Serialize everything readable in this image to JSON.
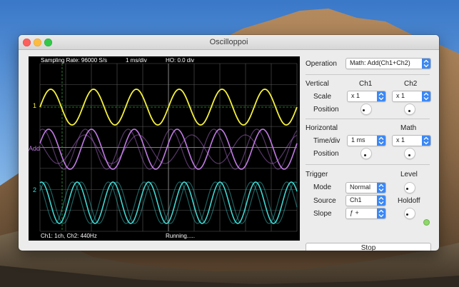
{
  "window": {
    "title": "Oscilloppoi"
  },
  "scope": {
    "sampling_rate": "Sampling Rate: 96000 S/s",
    "timebase": "1 ms/div",
    "ho": "HO: 0.0 div",
    "bottom_left": "Ch1: 1ch, Ch2: 440Hz",
    "status": "Running.....",
    "ch1_marker": "1",
    "math_marker": "Add",
    "ch2_marker": "2",
    "colors": {
      "ch1": "#f5f03c",
      "ch2": "#3fd9d4",
      "math": "#c27ae6",
      "grid": "#5a5a5a",
      "marker_ch1": "#f5f03c",
      "marker_math": "#c27ae6",
      "marker_ch2": "#3fd9d4",
      "trigger_line": "#3a9a3a"
    }
  },
  "panel": {
    "operation_label": "Operation",
    "operation_value": "Math: Add(Ch1+Ch2)",
    "vertical_label": "Vertical",
    "ch1_label": "Ch1",
    "ch2_label": "Ch2",
    "scale_label": "Scale",
    "ch1_scale": "x 1",
    "ch2_scale": "x 1",
    "position_label": "Position",
    "horizontal_label": "Horizontal",
    "math_label": "Math",
    "timediv_label": "Time/div",
    "timediv_value": "1 ms",
    "math_scale": "x 1",
    "hposition_label": "Position",
    "trigger_label": "Trigger",
    "level_label": "Level",
    "mode_label": "Mode",
    "mode_value": "Normal",
    "source_label": "Source",
    "source_value": "Ch1",
    "holdoff_label": "Holdoff",
    "slope_label": "Slope",
    "slope_value": "ƒ +",
    "stop_label": "Stop"
  }
}
